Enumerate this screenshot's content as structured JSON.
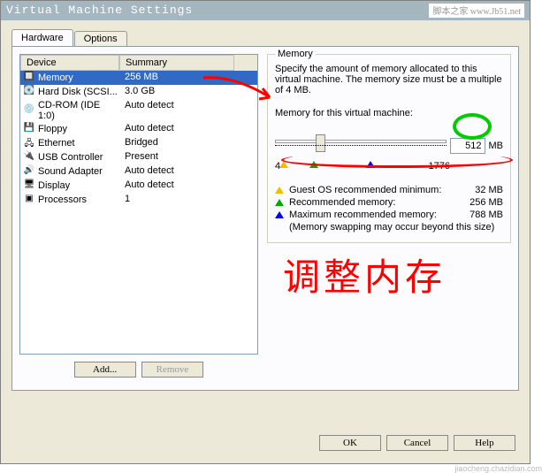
{
  "window": {
    "title": "Virtual Machine Settings",
    "site_tag": "脚本之家\nwww.Jb51.net"
  },
  "tabs": {
    "hardware": "Hardware",
    "options": "Options"
  },
  "list": {
    "col_device": "Device",
    "col_summary": "Summary",
    "rows": [
      {
        "device": "Memory",
        "summary": "256 MB",
        "icon": "🔲"
      },
      {
        "device": "Hard Disk (SCSI...",
        "summary": "3.0 GB",
        "icon": "💽"
      },
      {
        "device": "CD-ROM (IDE 1:0)",
        "summary": "Auto detect",
        "icon": "💿"
      },
      {
        "device": "Floppy",
        "summary": "Auto detect",
        "icon": "💾"
      },
      {
        "device": "Ethernet",
        "summary": "Bridged",
        "icon": "🖧"
      },
      {
        "device": "USB Controller",
        "summary": "Present",
        "icon": "🔌"
      },
      {
        "device": "Sound Adapter",
        "summary": "Auto detect",
        "icon": "🔊"
      },
      {
        "device": "Display",
        "summary": "Auto detect",
        "icon": "🖥"
      },
      {
        "device": "Processors",
        "summary": "1",
        "icon": "▣"
      }
    ]
  },
  "buttons": {
    "add": "Add...",
    "remove": "Remove",
    "ok": "OK",
    "cancel": "Cancel",
    "help": "Help"
  },
  "memory": {
    "group": "Memory",
    "desc": "Specify the amount of memory allocated to this virtual machine. The memory size must be a multiple of 4 MB.",
    "label": "Memory for this virtual machine:",
    "value": "512",
    "unit": "MB",
    "scale_min": "4",
    "scale_max": "1776",
    "legend": {
      "min": "Guest OS recommended minimum:",
      "min_val": "32 MB",
      "rec": "Recommended memory:",
      "rec_val": "256 MB",
      "max": "Maximum recommended memory:",
      "max_val": "788 MB",
      "swap": "(Memory swapping may occur beyond this size)"
    }
  },
  "annotation": {
    "text": "调整内存"
  }
}
